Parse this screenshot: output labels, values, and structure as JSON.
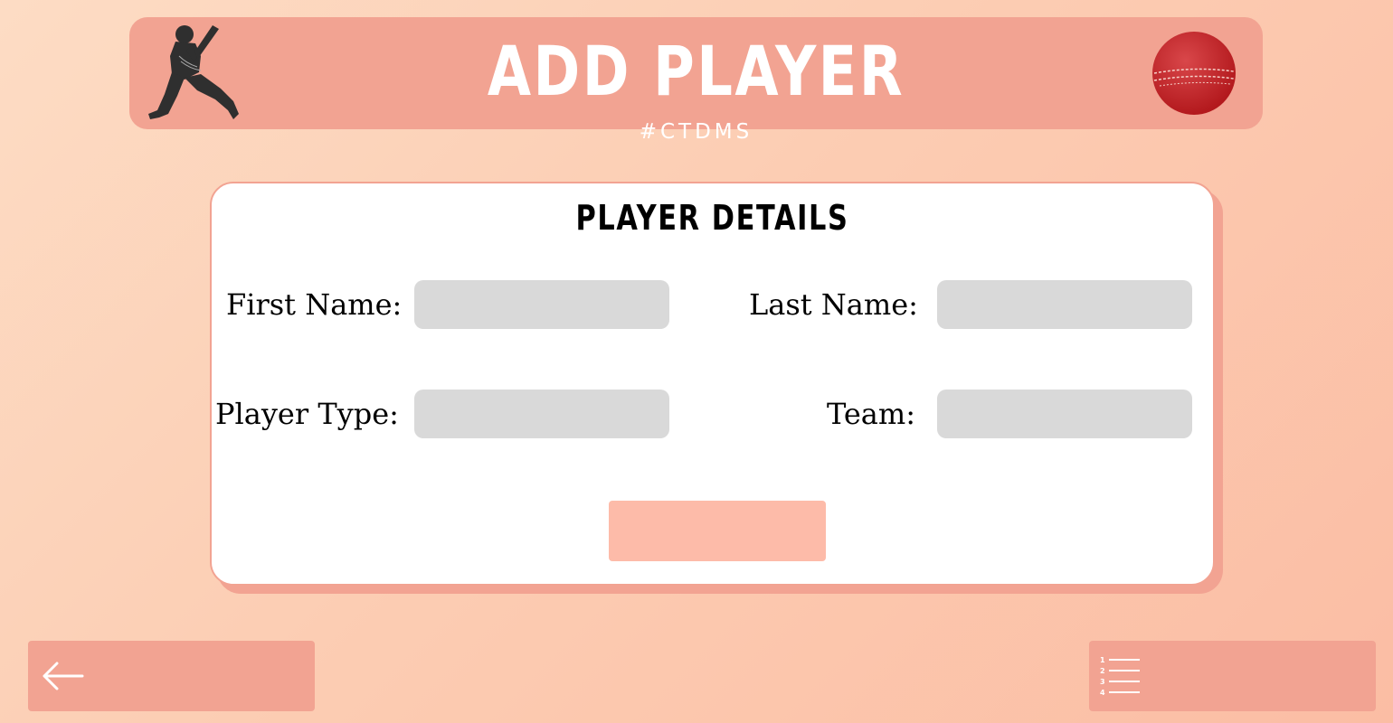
{
  "header": {
    "title": "ADD PLAYER",
    "subtitle": "#CTDMS",
    "left_icon": "cricket-batsman-icon",
    "right_icon": "cricket-ball-icon"
  },
  "form": {
    "title": "PLAYER DETAILS",
    "fields": [
      {
        "label": "First Name:",
        "value": "",
        "placeholder": ""
      },
      {
        "label": "Last Name:",
        "value": "",
        "placeholder": ""
      },
      {
        "label": "Player Type:",
        "value": "",
        "placeholder": ""
      },
      {
        "label": "Team:",
        "value": "",
        "placeholder": ""
      }
    ],
    "submit_label": ""
  },
  "navigation": {
    "back_icon": "arrow-left-icon",
    "list_icon": "numbered-list-icon"
  },
  "colors": {
    "background": "#fcd3bb",
    "header": "#f2a392",
    "card": "#ffffff",
    "input": "#d9d9d9",
    "submit": "#fdbba9"
  }
}
